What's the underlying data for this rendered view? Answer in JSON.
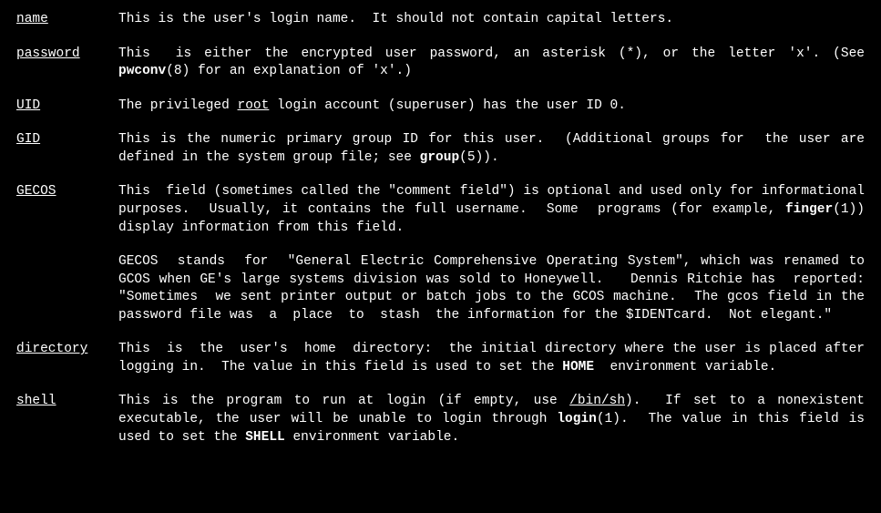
{
  "entries": [
    {
      "term": "name",
      "html": "This is the user's login name.  It should not contain capital letters."
    },
    {
      "term": "password",
      "html": "This  is either the encrypted user password, an asterisk (*), or the letter 'x'. (See <b>pwconv</b>(8) for an explanation of 'x'.)"
    },
    {
      "term": "UID",
      "html": "The privileged <u>root</u> login account (superuser) has the user ID 0."
    },
    {
      "term": "GID",
      "html": "This is the numeric primary group ID for this user.  (Additional groups for  the user are defined in the system group file; see <b>group</b>(5))."
    },
    {
      "term": "GECOS",
      "html": "This  field (sometimes called the \"comment field\") is optional and used only for informational purposes.  Usually, it contains the full username.  Some  programs (for example, <b>finger</b>(1)) display information from this field.||GECOS  stands  for  \"General Electric Comprehensive Operating System\", which was renamed to GCOS when GE's large systems division was sold to Honeywell.   Dennis Ritchie has  reported:  \"Sometimes  we sent printer output or batch jobs to the GCOS machine.  The gcos field in the password file was  a  place  to  stash  the information for the $IDENTcard.  Not elegant.\""
    },
    {
      "term": "directory",
      "html": "This  is  the  user's  home  directory:  the initial directory where the user is placed after logging in.  The value in this field is used to set the <b>HOME</b>  environment variable."
    },
    {
      "term": "shell",
      "html": "This is the program to run at login (if empty, use <u>/bin/sh</u>).  If set to a nonexistent executable, the user will be unable to login through <b>login</b>(1).  The value in this field is used to set the <b>SHELL</b> environment variable."
    }
  ]
}
